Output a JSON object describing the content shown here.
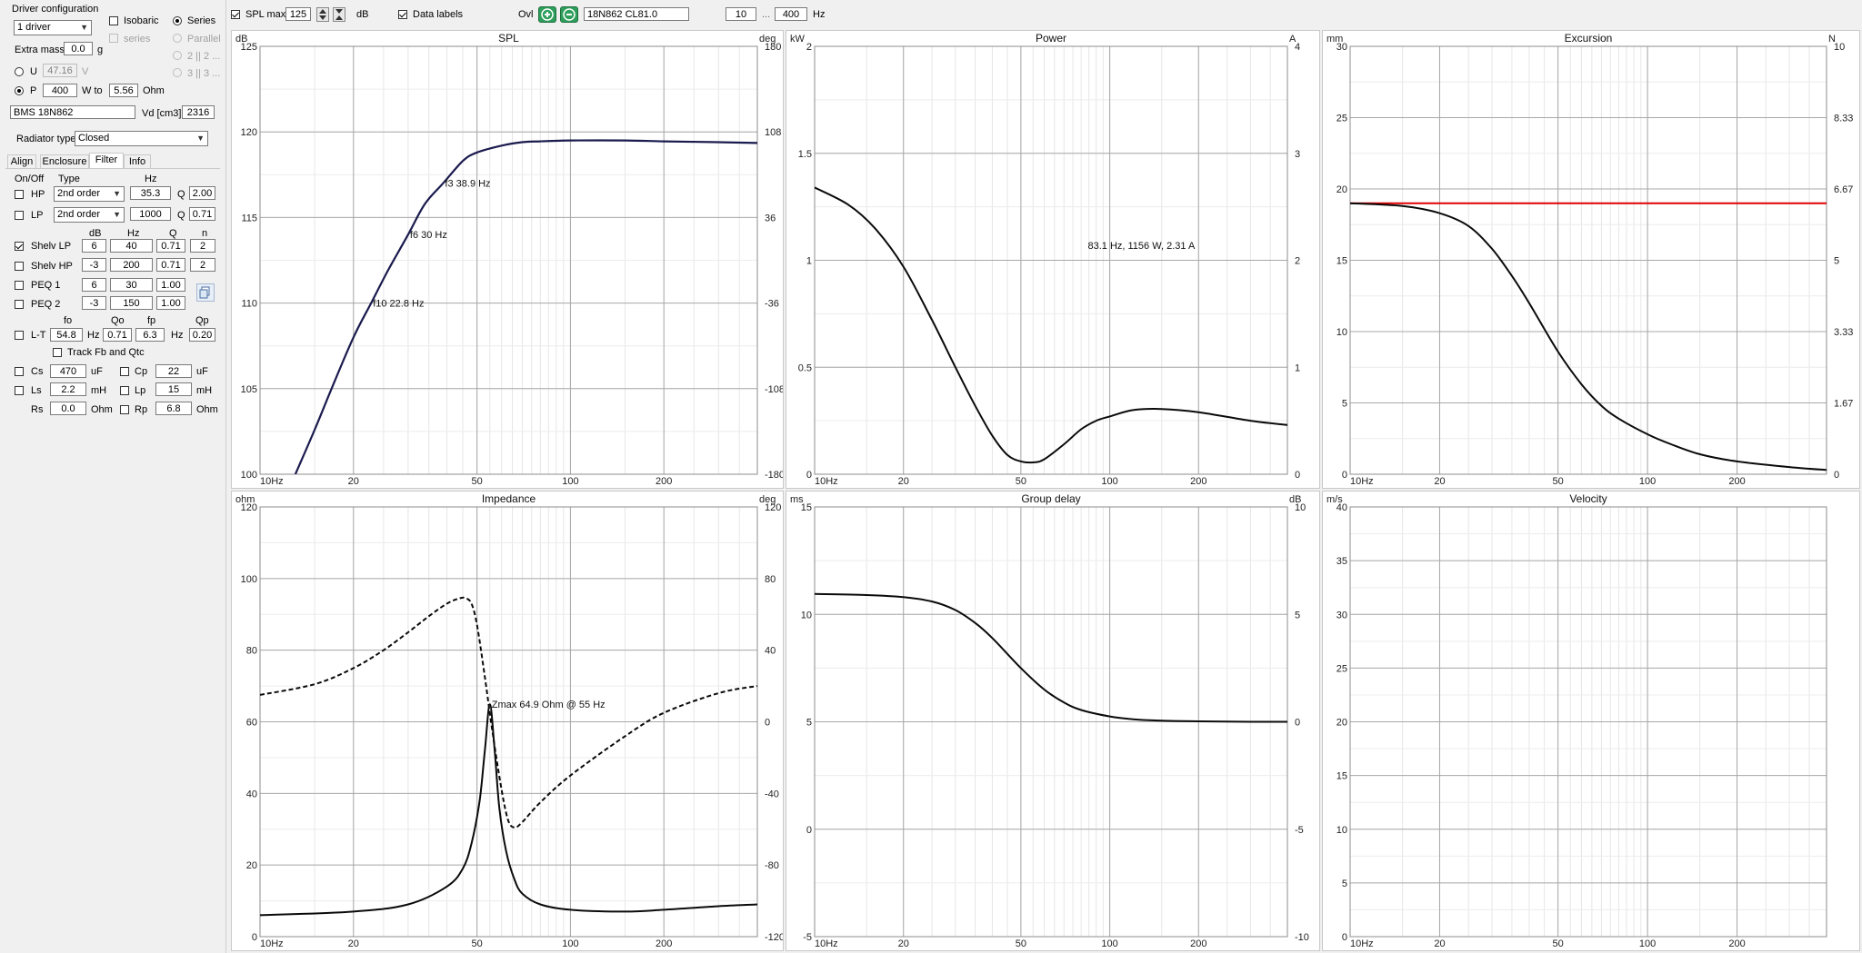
{
  "toolbar": {
    "spl_max_label": "SPL max",
    "spl_max_checked": true,
    "spl_max_value": "125",
    "spl_max_unit": "dB",
    "data_labels_label": "Data labels",
    "data_labels_checked": true,
    "ovl_label": "Ovl",
    "ovl_value": "18N862 CL81.0",
    "freq_min": "10",
    "freq_sep": "...",
    "freq_max": "400",
    "freq_unit": "Hz"
  },
  "driver": {
    "group_title": "Driver configuration",
    "count_select": "1 driver",
    "isobaric_label": "Isobaric",
    "series_label": "Series",
    "series_sub_label": "series",
    "parallel_label": "Parallel",
    "option_2x2": "2 || 2 ...",
    "option_3x3": "3 || 3 ...",
    "extra_mass_label": "Extra mass",
    "extra_mass_value": "0.0",
    "extra_mass_unit": "g",
    "u_label": "U",
    "u_value": "47.16",
    "u_unit": "V",
    "p_label": "P",
    "p_value": "400",
    "w_to_label": "W to",
    "ohm_value": "5.56",
    "ohm_unit": "Ohm",
    "model": "BMS 18N862",
    "vd_label": "Vd [cm3]",
    "vd_value": "2316",
    "radiator_label": "Radiator type",
    "radiator_value": "Closed"
  },
  "tabs": [
    "Align",
    "Enclosure",
    "Filter",
    "Info"
  ],
  "filter": {
    "hdr_onoff": "On/Off",
    "hdr_type": "Type",
    "hdr_hz": "Hz",
    "hp_label": "HP",
    "hp_type": "2nd order",
    "hp_hz": "35.3",
    "hp_q_label": "Q",
    "hp_q": "2.00",
    "lp_label": "LP",
    "lp_type": "2nd order",
    "lp_hz": "1000",
    "lp_q_label": "Q",
    "lp_q": "0.71",
    "hdr_db": "dB",
    "hdr_hz2": "Hz",
    "hdr_q": "Q",
    "hdr_n": "n",
    "rows": [
      {
        "label": "Shelv LP",
        "checked": true,
        "db": "6",
        "hz": "40",
        "q": "0.71",
        "n": "2"
      },
      {
        "label": "Shelv HP",
        "checked": false,
        "db": "-3",
        "hz": "200",
        "q": "0.71",
        "n": "2"
      },
      {
        "label": "PEQ 1",
        "checked": false,
        "db": "6",
        "hz": "30",
        "q": "1.00",
        "n": ""
      },
      {
        "label": "PEQ 2",
        "checked": false,
        "db": "-3",
        "hz": "150",
        "q": "1.00",
        "n": ""
      }
    ],
    "hdr_fo": "fo",
    "hdr_qo": "Qo",
    "hdr_fp": "fp",
    "hdr_qp": "Qp",
    "lt_label": "L-T",
    "lt_fo": "54.8",
    "lt_hz1": "Hz",
    "lt_qo": "0.71",
    "lt_fp": "6.3",
    "lt_hz2": "Hz",
    "lt_qp": "0.20",
    "track_label": "Track Fb and Qtc",
    "cs_label": "Cs",
    "cs_value": "470",
    "cs_unit": "uF",
    "cp_label": "Cp",
    "cp_value": "22",
    "cp_unit": "uF",
    "ls_label": "Ls",
    "ls_value": "2.2",
    "ls_unit": "mH",
    "lp2_label": "Lp",
    "lp2_value": "15",
    "lp2_unit": "mH",
    "rs_label": "Rs",
    "rs_value": "0.0",
    "rs_unit": "Ohm",
    "rp_label": "Rp",
    "rp_value": "6.8",
    "rp_unit": "Ohm"
  },
  "colors": {
    "accent_green": "#2e9e5b",
    "curve": "#0a0a0a",
    "spl_curve": "#1a1a4e",
    "excursion_limit": "#e00000"
  },
  "chart_data": [
    {
      "id": "spl",
      "type": "line",
      "title": "SPL",
      "ylabel": "dB",
      "y2label": "deg",
      "xscale": "log",
      "xlim": [
        10,
        400
      ],
      "ylim": [
        100,
        125
      ],
      "y2lim": [
        -180,
        180
      ],
      "xticks": [
        "10Hz",
        "20",
        "50",
        "100",
        "200"
      ],
      "yticks": [
        "100",
        "105",
        "110",
        "115",
        "120",
        "125"
      ],
      "y2ticks": [
        "-180",
        "-108",
        "-36",
        "36",
        "108",
        "180"
      ],
      "series": [
        {
          "x": [
            13,
            15,
            17,
            20,
            22.8,
            26,
            30,
            34,
            38.9,
            45,
            50,
            60,
            70,
            80,
            100,
            150,
            200,
            300,
            400
          ],
          "y": [
            100,
            102.6,
            105,
            108,
            110,
            112,
            114,
            115.8,
            117,
            118.3,
            118.8,
            119.2,
            119.4,
            119.45,
            119.5,
            119.5,
            119.45,
            119.4,
            119.35
          ]
        }
      ],
      "annotations": [
        {
          "text": "f3 38.9 Hz",
          "x": 38.9,
          "y": 117
        },
        {
          "text": "f6 30 Hz",
          "x": 30,
          "y": 114
        },
        {
          "text": "f10 22.8 Hz",
          "x": 22.8,
          "y": 110
        }
      ]
    },
    {
      "id": "power",
      "type": "line",
      "title": "Power",
      "ylabel": "kW",
      "y2label": "A",
      "xscale": "log",
      "xlim": [
        10,
        400
      ],
      "ylim": [
        0,
        2
      ],
      "y2lim": [
        0,
        4
      ],
      "xticks": [
        "10Hz",
        "20",
        "50",
        "100",
        "200"
      ],
      "yticks": [
        "0",
        "0.5",
        "1",
        "1.5",
        "2"
      ],
      "y2ticks": [
        "0",
        "1",
        "2",
        "3",
        "4"
      ],
      "series": [
        {
          "x": [
            10,
            13,
            16,
            20,
            25,
            30,
            35,
            40,
            45,
            50,
            55,
            60,
            70,
            80,
            90,
            100,
            120,
            150,
            200,
            300,
            400
          ],
          "y": [
            1.34,
            1.26,
            1.15,
            0.97,
            0.72,
            0.5,
            0.32,
            0.18,
            0.09,
            0.06,
            0.055,
            0.07,
            0.14,
            0.21,
            0.25,
            0.27,
            0.3,
            0.305,
            0.29,
            0.25,
            0.23
          ]
        }
      ],
      "annotations": [
        {
          "text": "83.1 Hz, 1156 W, 2.31 A",
          "x": 83.1,
          "y": 1.07
        }
      ]
    },
    {
      "id": "excursion",
      "type": "line",
      "title": "Excursion",
      "ylabel": "mm",
      "y2label": "N",
      "xscale": "log",
      "xlim": [
        10,
        400
      ],
      "ylim": [
        0,
        30
      ],
      "y2lim": [
        0,
        10
      ],
      "xticks": [
        "10Hz",
        "20",
        "50",
        "100",
        "200"
      ],
      "yticks": [
        "0",
        "5",
        "10",
        "15",
        "20",
        "25",
        "30"
      ],
      "y2ticks": [
        "0",
        "1.67",
        "3.33",
        "5",
        "6.67",
        "8.33",
        "10"
      ],
      "series": [
        {
          "x": [
            10,
            15,
            20,
            25,
            30,
            35,
            40,
            50,
            60,
            70,
            80,
            100,
            120,
            150,
            200,
            300,
            400
          ],
          "y": [
            19,
            18.8,
            18.3,
            17.4,
            15.8,
            13.9,
            12,
            8.6,
            6.3,
            4.8,
            3.9,
            2.8,
            2.1,
            1.4,
            0.9,
            0.5,
            0.3
          ]
        }
      ],
      "limit": 19
    },
    {
      "id": "impedance",
      "type": "line",
      "title": "Impedance",
      "ylabel": "ohm",
      "y2label": "deg",
      "xscale": "log",
      "xlim": [
        10,
        400
      ],
      "ylim": [
        0,
        120
      ],
      "y2lim": [
        -120,
        120
      ],
      "xticks": [
        "10Hz",
        "20",
        "50",
        "100",
        "200"
      ],
      "yticks": [
        "0",
        "20",
        "40",
        "60",
        "80",
        "100",
        "120"
      ],
      "y2ticks": [
        "-120",
        "-80",
        "-40",
        "0",
        "40",
        "80",
        "120"
      ],
      "series": [
        {
          "x": [
            10,
            20,
            30,
            40,
            45,
            48,
            51,
            53,
            55,
            57,
            59,
            62,
            66,
            70,
            80,
            100,
            150,
            200,
            300,
            400
          ],
          "y": [
            6,
            7,
            9,
            14,
            19,
            26,
            38,
            52,
            64.9,
            52,
            36,
            24,
            16,
            12,
            9,
            7.5,
            7,
            7.5,
            8.5,
            9
          ]
        },
        {
          "x": [
            10,
            15,
            20,
            25,
            30,
            35,
            40,
            44,
            46,
            48,
            50,
            53,
            56,
            60,
            63,
            66,
            70,
            80,
            100,
            150,
            200,
            300,
            400
          ],
          "y": [
            15,
            21,
            30,
            40,
            50,
            59,
            66,
            69,
            69,
            66,
            54,
            25,
            -5,
            -38,
            -55,
            -59,
            -56,
            -45,
            -30,
            -8,
            5,
            16,
            20
          ]
        }
      ],
      "annotations": [
        {
          "text": "Zmax 64.9 Ohm @ 55 Hz",
          "x": 55,
          "y": 64.9
        }
      ]
    },
    {
      "id": "group_delay",
      "type": "line",
      "title": "Group delay",
      "ylabel": "ms",
      "y2label": "dB",
      "xscale": "log",
      "xlim": [
        10,
        400
      ],
      "ylim": [
        -5,
        15
      ],
      "y2lim": [
        -10,
        10
      ],
      "xticks": [
        "10Hz",
        "20",
        "50",
        "100",
        "200"
      ],
      "yticks": [
        "-5",
        "0",
        "5",
        "10",
        "15"
      ],
      "y2ticks": [
        "-10",
        "-5",
        "0",
        "5",
        "10"
      ],
      "series": [
        {
          "x": [
            10,
            15,
            20,
            25,
            30,
            35,
            40,
            50,
            60,
            70,
            80,
            100,
            120,
            150,
            200,
            300,
            400
          ],
          "y": [
            10.95,
            10.9,
            10.8,
            10.6,
            10.2,
            9.6,
            8.9,
            7.5,
            6.5,
            5.9,
            5.55,
            5.25,
            5.12,
            5.05,
            5.02,
            5.0,
            5.0
          ]
        }
      ]
    },
    {
      "id": "velocity",
      "type": "line",
      "title": "Velocity",
      "ylabel": "m/s",
      "y2label": "",
      "xscale": "log",
      "xlim": [
        10,
        400
      ],
      "ylim": [
        0,
        40
      ],
      "xticks": [
        "10Hz",
        "20",
        "50",
        "100",
        "200"
      ],
      "yticks": [
        "0",
        "5",
        "10",
        "15",
        "20",
        "25",
        "30",
        "35",
        "40"
      ],
      "y2ticks": [],
      "series": []
    }
  ]
}
